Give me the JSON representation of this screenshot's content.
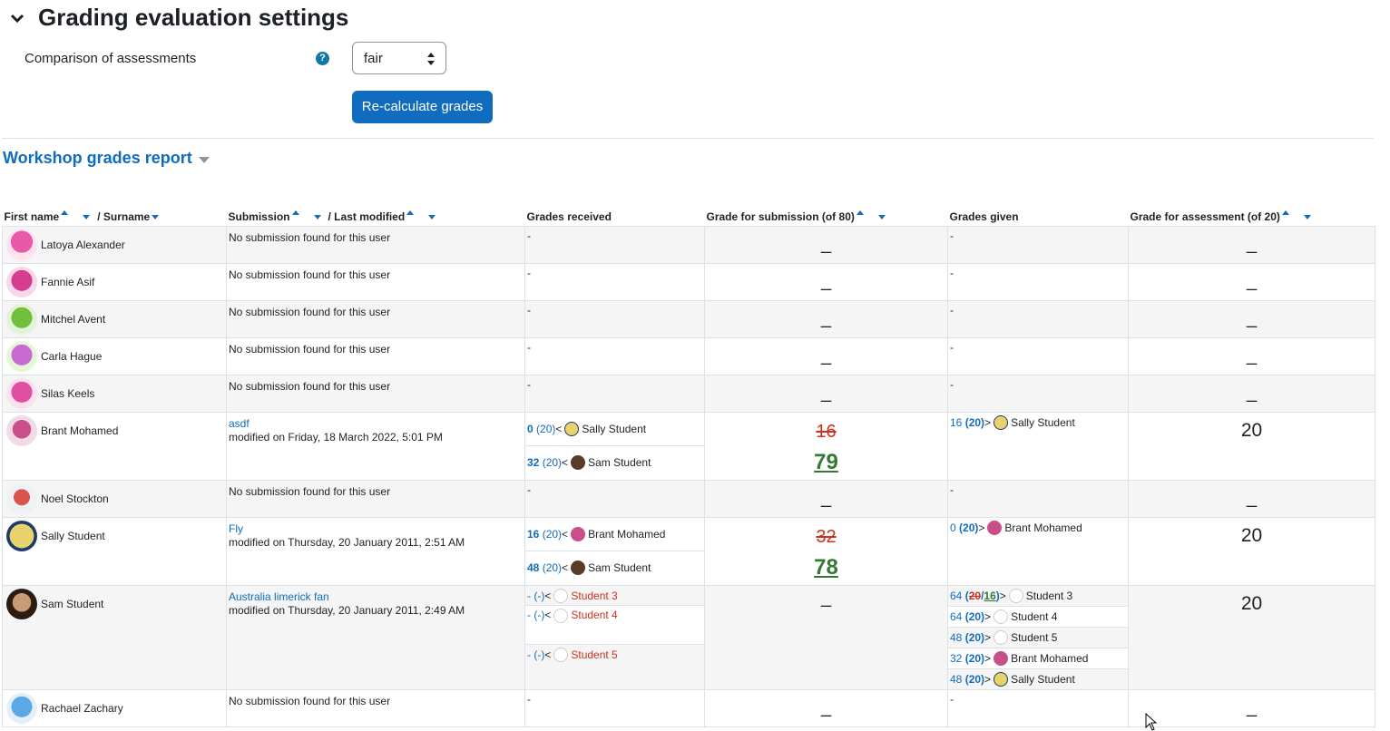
{
  "section": {
    "title": "Grading evaluation settings"
  },
  "settings": {
    "comparison_label": "Comparison of assessments",
    "help_glyph": "?",
    "comparison_value": "fair",
    "recalc_button": "Re-calculate grades"
  },
  "report": {
    "title": "Workshop grades report",
    "headers": {
      "first_name": "First name",
      "surname": "/ Surname",
      "submission": "Submission",
      "last_modified": "/ Last modified",
      "grades_received": "Grades received",
      "grade_submission": "Grade for submission (of 80)",
      "grades_given": "Grades given",
      "grade_assessment": "Grade for assessment (of 20)"
    },
    "no_submission": "No submission found for this user",
    "dash": "-",
    "bigdash": "_",
    "rows": {
      "r0": {
        "name": "Latoya Alexander",
        "avatar_color": "#e85aa8"
      },
      "r1": {
        "name": "Fannie Asif",
        "avatar_color": "#d63d8f"
      },
      "r2": {
        "name": "Mitchel Avent",
        "avatar_color": "#6fbf3b"
      },
      "r3": {
        "name": "Carla Hague",
        "avatar_color": "#c86ad0"
      },
      "r4": {
        "name": "Silas Keels",
        "avatar_color": "#e04fa0"
      },
      "r5": {
        "name": "Brant Mohamed",
        "avatar_color": "#c94f8a",
        "submission_title": "asdf",
        "submission_modified": "modified on Friday, 18 March 2022, 5:01 PM",
        "received": [
          {
            "grade": "0",
            "max": "(20)",
            "arrow": "<",
            "who": "Sally Student"
          },
          {
            "grade": "32",
            "max": "(20)",
            "arrow": "<",
            "who": "Sam Student"
          }
        ],
        "sub_old": "16",
        "sub_final": "79",
        "given": [
          {
            "grade": "16",
            "max": "(20)",
            "arrow": ">",
            "who": "Sally Student"
          }
        ],
        "assess": "20"
      },
      "r6": {
        "name": "Noel Stockton",
        "avatar_color": "#d9534f"
      },
      "r7": {
        "name": "Sally Student",
        "avatar_color": "#1f3b6b",
        "submission_title": "Fly",
        "submission_modified": "modified on Thursday, 20 January 2011, 2:51 AM",
        "received": [
          {
            "grade": "16",
            "max": "(20)",
            "arrow": "<",
            "who": "Brant Mohamed"
          },
          {
            "grade": "48",
            "max": "(20)",
            "arrow": "<",
            "who": "Sam Student"
          }
        ],
        "sub_old": "32",
        "sub_final": "78",
        "given": [
          {
            "grade": "0",
            "max": "(20)",
            "arrow": ">",
            "who": "Brant Mohamed"
          }
        ],
        "assess": "20"
      },
      "r8": {
        "name": "Sam Student",
        "avatar_color": "#5a3b2a",
        "submission_title": "Australia limerick fan",
        "submission_modified": "modified on Thursday, 20 January 2011, 2:49 AM",
        "received": [
          {
            "grade": "-",
            "max": "(-)",
            "arrow": "<",
            "who": "Student 3"
          },
          {
            "grade": "-",
            "max": "(-)",
            "arrow": "<",
            "who": "Student 4"
          },
          {
            "grade": "-",
            "max": "(-)",
            "arrow": "<",
            "who": "Student 5"
          }
        ],
        "given": [
          {
            "grade": "64",
            "open": "(",
            "old": "20",
            "slash": " / ",
            "new": "16",
            "close": ")",
            "arrow": ">",
            "who": "Student 3"
          },
          {
            "grade": "64",
            "max": "(20)",
            "arrow": ">",
            "who": "Student 4"
          },
          {
            "grade": "48",
            "max": "(20)",
            "arrow": ">",
            "who": "Student 5"
          },
          {
            "grade": "32",
            "max": "(20)",
            "arrow": ">",
            "who": "Brant Mohamed"
          },
          {
            "grade": "48",
            "max": "(20)",
            "arrow": ">",
            "who": "Sally Student"
          }
        ],
        "assess": "20"
      },
      "r9": {
        "name": "Rachael Zachary",
        "avatar_color": "#5aa9e6"
      }
    }
  },
  "colors": {
    "brand": "#0f6cbf",
    "danger": "#ca3120",
    "success": "#357a32"
  }
}
